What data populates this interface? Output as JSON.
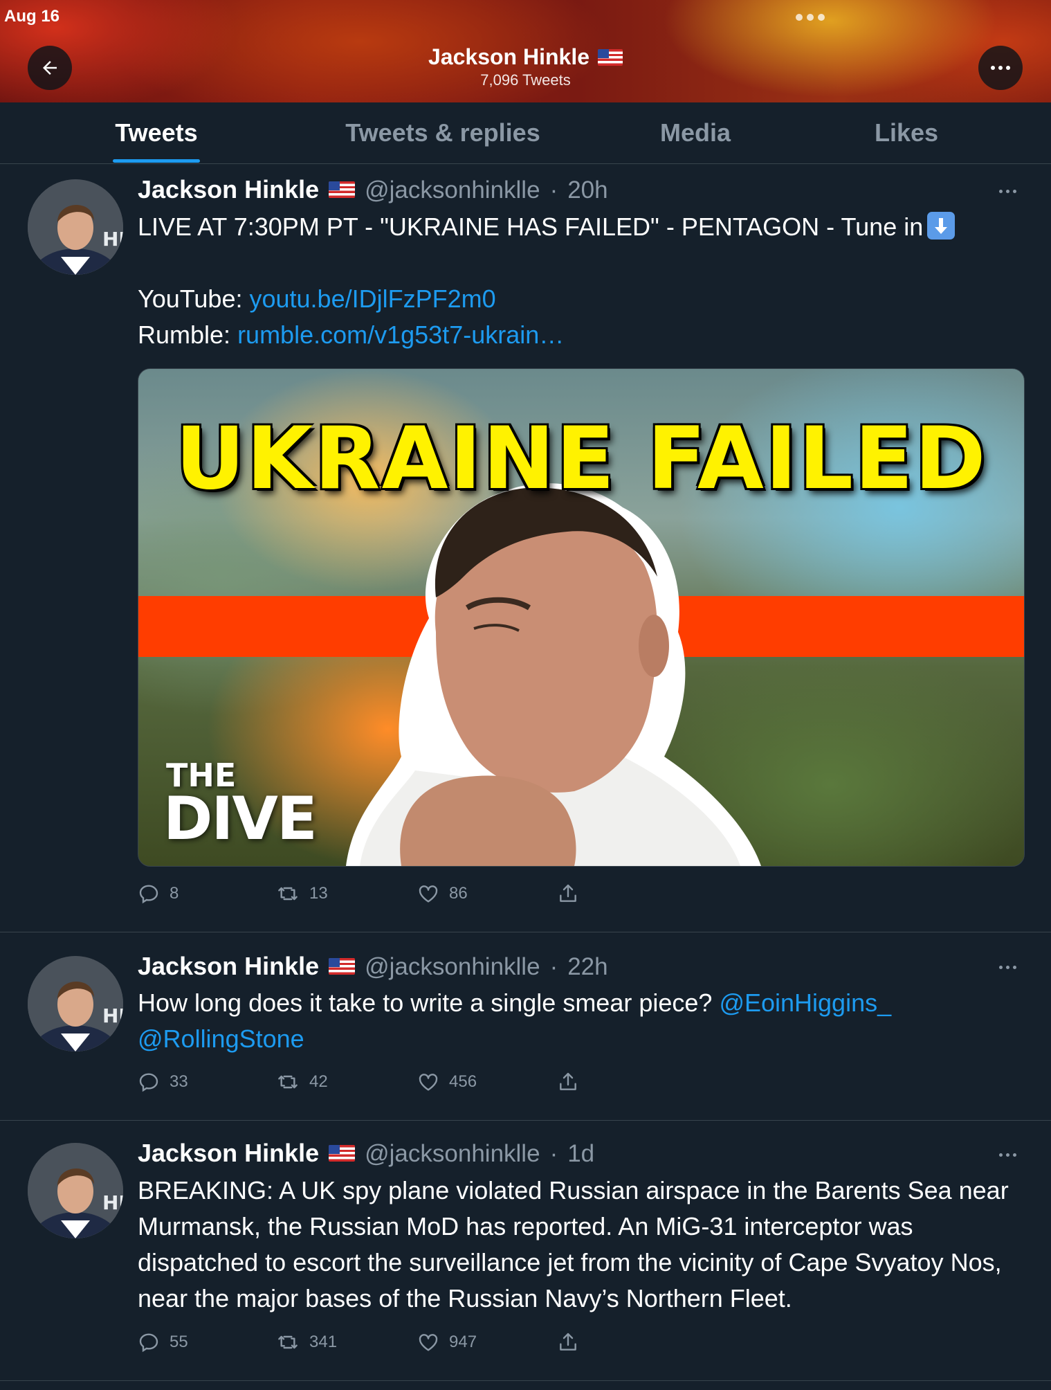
{
  "status_bar": {
    "date": "Aug 16"
  },
  "profile": {
    "name": "Jackson Hinkle",
    "tweet_count": "7,096 Tweets"
  },
  "tabs": [
    {
      "label": "Tweets",
      "active": true
    },
    {
      "label": "Tweets & replies",
      "active": false
    },
    {
      "label": "Media",
      "active": false
    },
    {
      "label": "Likes",
      "active": false
    }
  ],
  "colors": {
    "accent": "#1d9bf0",
    "background": "#15202b",
    "muted": "#8b98a5",
    "header": "#8c1e12"
  },
  "tweets": [
    {
      "name": "Jackson Hinkle",
      "handle": "@jacksonhinklle",
      "sep": "·",
      "time": "20h",
      "line1": "LIVE AT 7:30PM PT - \"UKRAINE HAS FAILED\" - PENTAGON - Tune in",
      "youtube_label": "YouTube: ",
      "youtube_link": "youtu.be/IDjlFzPF2m0",
      "rumble_label": "Rumble: ",
      "rumble_link": "rumble.com/v1g53t7-ukrain…",
      "media": {
        "title": "UKRAINE FAILED",
        "brand_small": "THE",
        "brand_big": "DIVE"
      },
      "replies": "8",
      "retweets": "13",
      "likes": "86"
    },
    {
      "name": "Jackson Hinkle",
      "handle": "@jacksonhinklle",
      "sep": "·",
      "time": "22h",
      "text": "How long does it take to write a single smear piece? ",
      "mention1": "@EoinHiggins_",
      "mention2": "@RollingStone",
      "replies": "33",
      "retweets": "42",
      "likes": "456"
    },
    {
      "name": "Jackson Hinkle",
      "handle": "@jacksonhinklle",
      "sep": "·",
      "time": "1d",
      "text": "BREAKING: A UK spy plane violated Russian airspace in the Barents Sea near Murmansk, the Russian MoD has reported. An MiG-31 interceptor was dispatched to escort the surveillance jet from the vicinity of Cape Svyatoy Nos, near the major bases of the Russian Navy’s Northern Fleet.",
      "replies": "55",
      "retweets": "341",
      "likes": "947"
    }
  ]
}
